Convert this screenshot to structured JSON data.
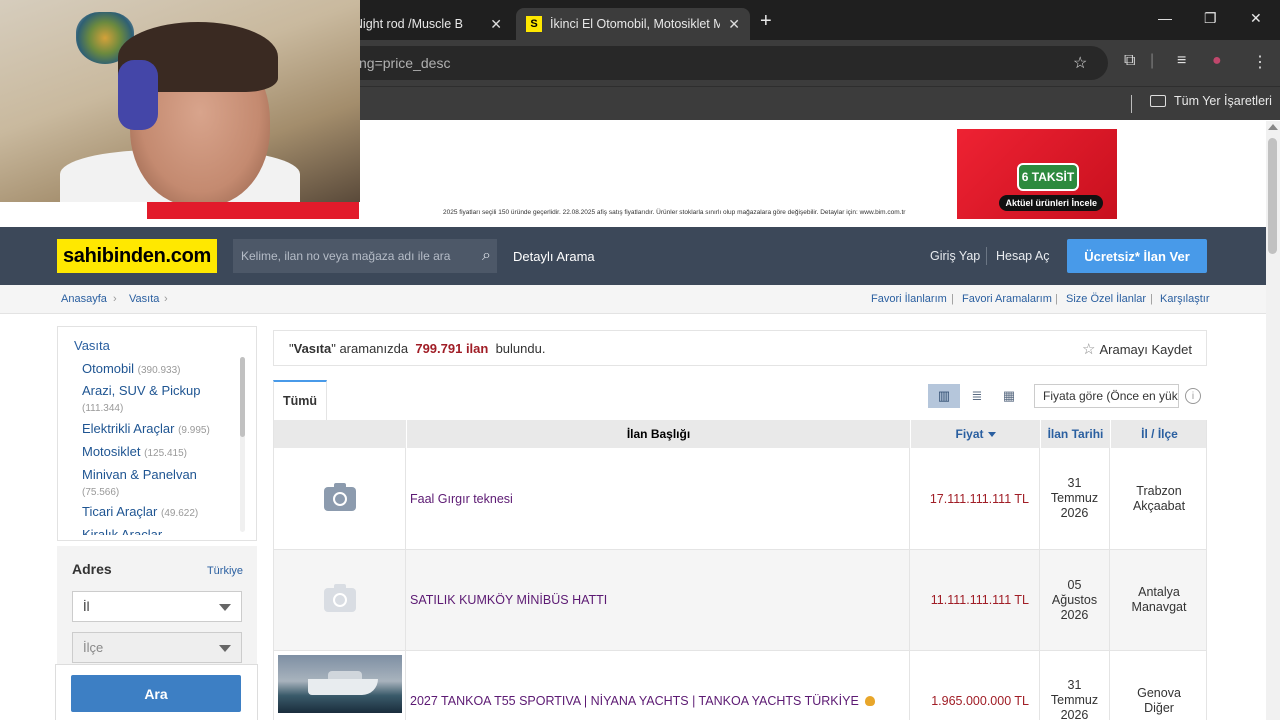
{
  "browser": {
    "tabs": [
      {
        "title": "d /Night rod /Muscle B"
      },
      {
        "title": "İkinci El Otomobil, Motosiklet M",
        "favicon": "S"
      }
    ],
    "address": "ting=price_desc",
    "bookmarks_folder": "Tüm Yer İşaretleri"
  },
  "ad": {
    "fine_print": "2025 fiyatları seçili 150 üründe geçerlidir. 22.08.2025 afiş satış fiyatlarıdır. Ürünler stoklarla sınırlı olup mağazalara göre değişebilir. Detaylar için: www.bim.com.tr",
    "badge": "6 TAKSİT",
    "cta": "Aktüel ürünleri İncele"
  },
  "header": {
    "logo": "sahibinden.com",
    "search_placeholder": "Kelime, ilan no veya mağaza adı ile ara",
    "detailed_search": "Detaylı Arama",
    "login": "Giriş Yap",
    "register": "Hesap Aç",
    "post_ad": "Ücretsiz* İlan Ver"
  },
  "breadcrumb": [
    "Anasayfa",
    "Vasıta"
  ],
  "sublinks": [
    "Favori İlanlarım",
    "Favori Aramalarım",
    "Size Özel İlanlar",
    "Karşılaştır"
  ],
  "sidebar": {
    "category_title": "Vasıta",
    "categories": [
      {
        "label": "Otomobil",
        "count": "(390.933)"
      },
      {
        "label": "Arazi, SUV & Pickup",
        "count": "(111.344)"
      },
      {
        "label": "Elektrikli Araçlar",
        "count": "(9.995)"
      },
      {
        "label": "Motosiklet",
        "count": "(125.415)"
      },
      {
        "label": "Minivan & Panelvan",
        "count": "(75.566)"
      },
      {
        "label": "Ticari Araçlar",
        "count": "(49.622)"
      },
      {
        "label": "Kiralık Araçlar",
        "count": ""
      }
    ],
    "address_title": "Adres",
    "address_link": "Türkiye",
    "city_select": "İl",
    "district_select": "İlçe",
    "search_button": "Ara"
  },
  "results": {
    "query_open": "\"",
    "query_term": "Vasıta",
    "query_close": "\" aramanızda",
    "count": "799.791 ilan",
    "suffix": "bulundu.",
    "save_search": "Aramayı Kaydet",
    "tab_all": "Tümü",
    "sort": "Fiyata göre (Önce en yüksek)"
  },
  "table": {
    "headers": {
      "title": "İlan Başlığı",
      "price": "Fiyat",
      "date": "İlan Tarihi",
      "location": "İl / İlçe"
    },
    "rows": [
      {
        "title": "Faal Gırgır teknesi",
        "price": "17.111.111.111 TL",
        "date_day": "31",
        "date_month": "Temmuz",
        "date_year": "2026",
        "city": "Trabzon",
        "district": "Akçaabat"
      },
      {
        "title": "SATILIK KUMKÖY MİNİBÜS HATTI",
        "price": "11.111.111.111 TL",
        "date_day": "05",
        "date_month": "Ağustos",
        "date_year": "2026",
        "city": "Antalya",
        "district": "Manavgat"
      },
      {
        "title": "2027 TANKOA T55 SPORTIVA | NİYANA YACHTS | TANKOA YACHTS TÜRKİYE",
        "price": "1.965.000.000 TL",
        "date_day": "31",
        "date_month": "Temmuz",
        "date_year": "2026",
        "city": "Genova",
        "district": "Diğer"
      }
    ]
  }
}
